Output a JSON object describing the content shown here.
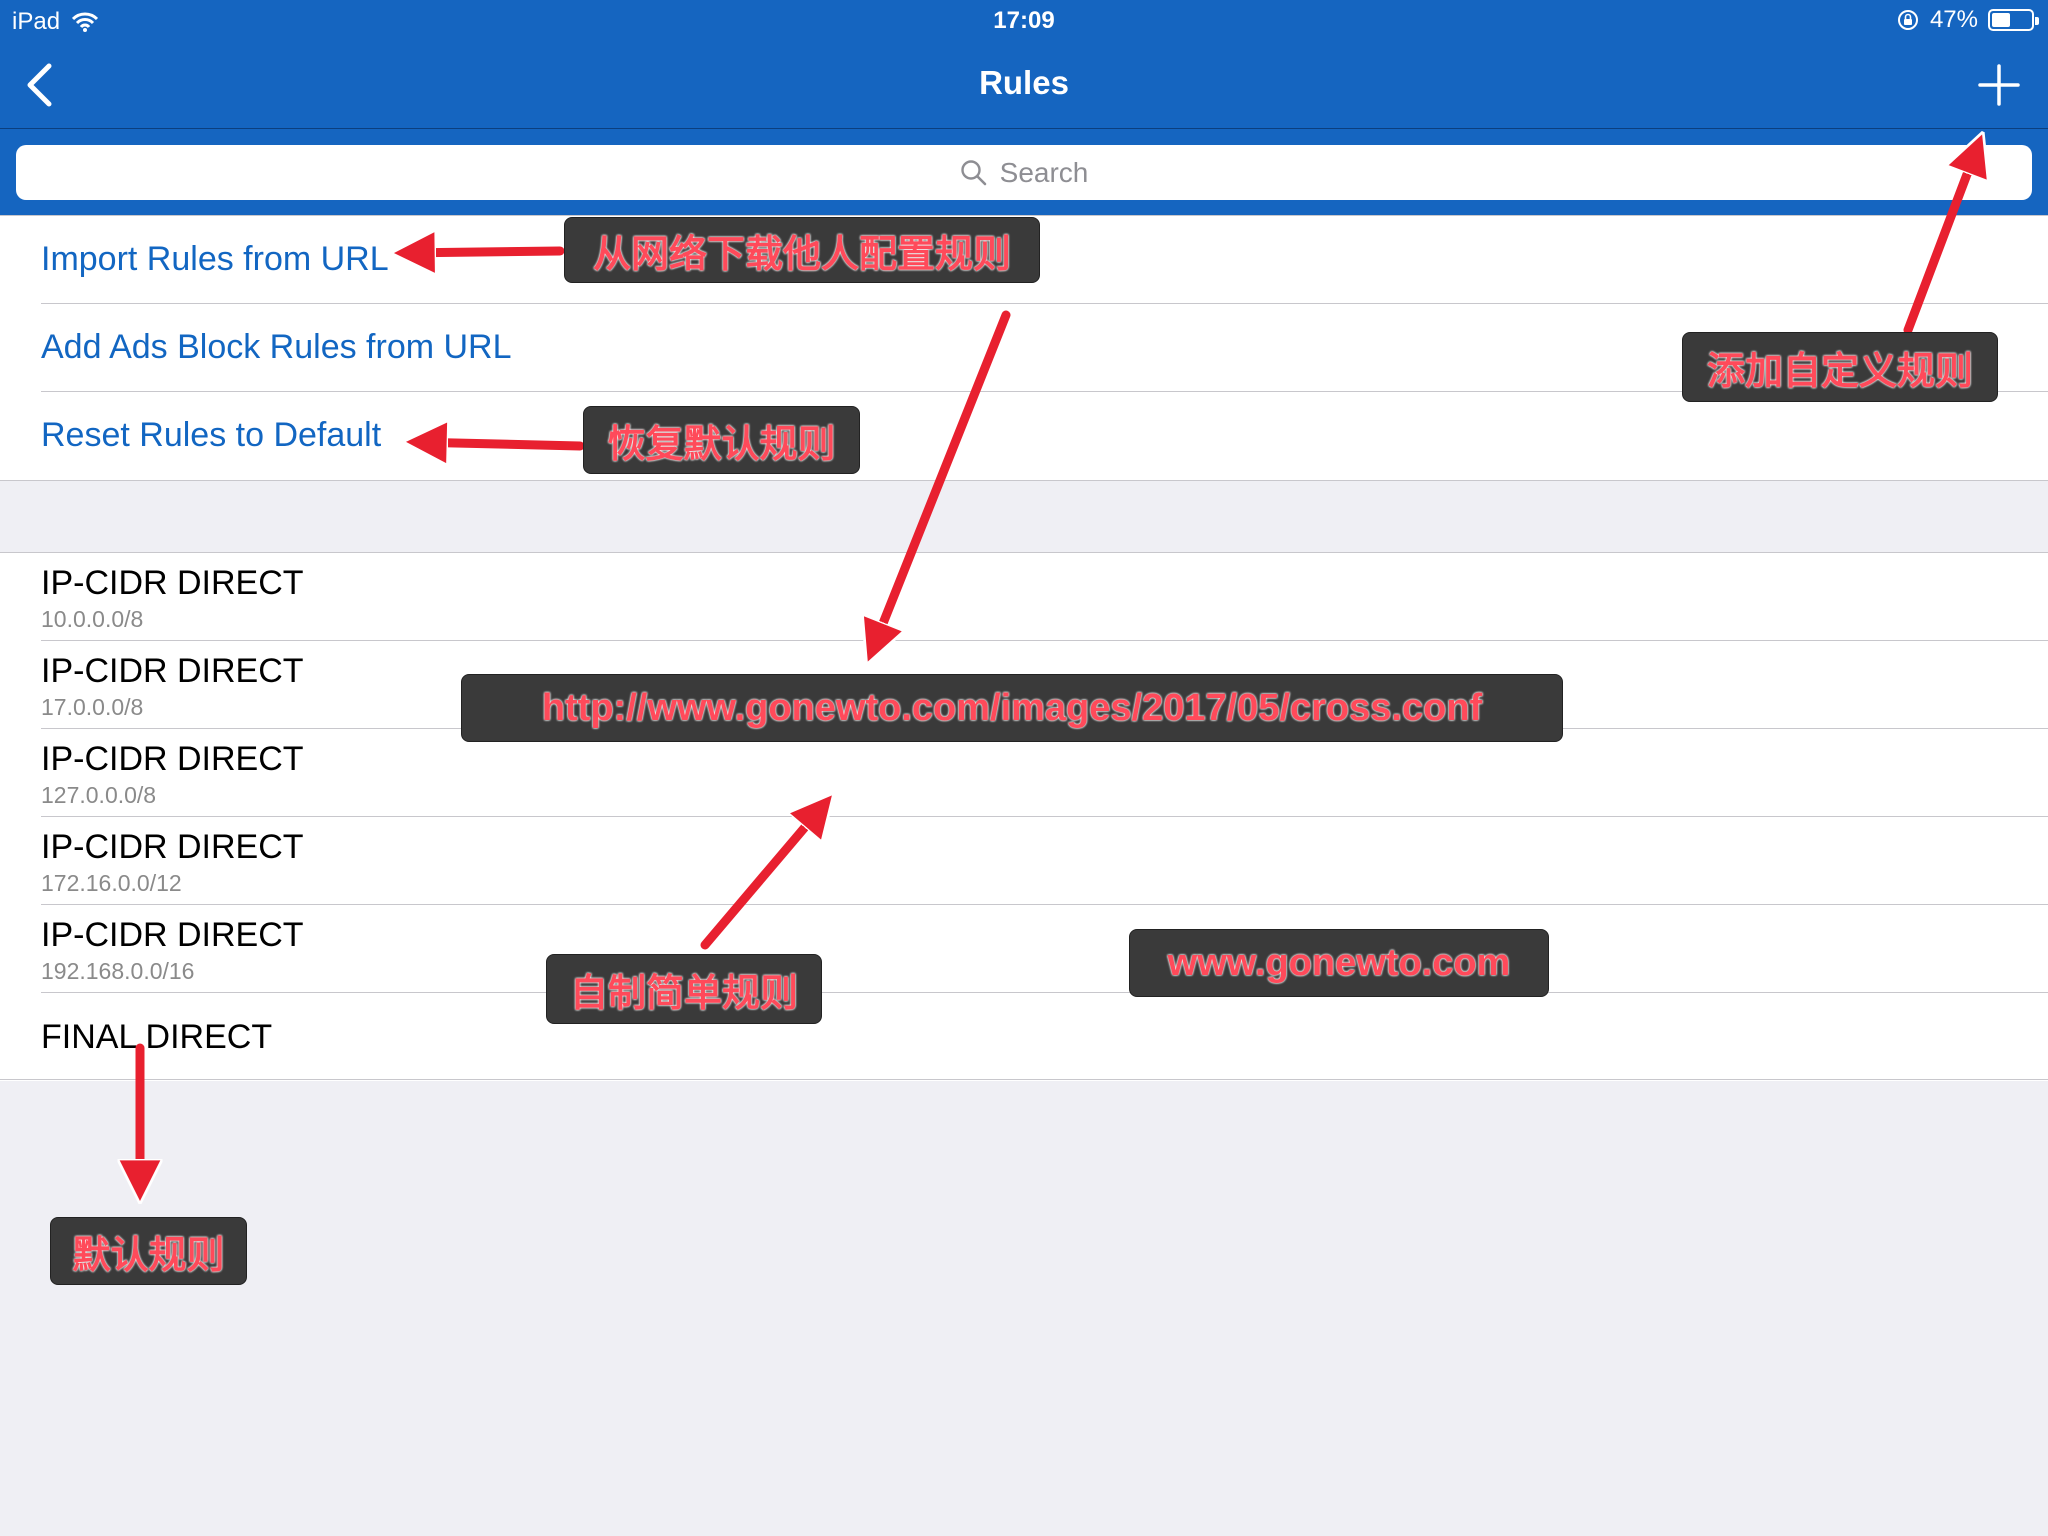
{
  "status_bar": {
    "device": "iPad",
    "time": "17:09",
    "battery_text": "47%",
    "battery_level": 0.47
  },
  "nav": {
    "title": "Rules",
    "back_icon": "chevron-left-icon",
    "add_icon": "plus-icon"
  },
  "search": {
    "placeholder": "Search"
  },
  "actions": [
    {
      "label": "Import Rules from URL"
    },
    {
      "label": "Add Ads Block Rules from URL"
    },
    {
      "label": "Reset Rules to Default"
    }
  ],
  "rules": [
    {
      "title": "IP-CIDR DIRECT",
      "value": "10.0.0.0/8"
    },
    {
      "title": "IP-CIDR DIRECT",
      "value": "17.0.0.0/8"
    },
    {
      "title": "IP-CIDR DIRECT",
      "value": "127.0.0.0/8"
    },
    {
      "title": "IP-CIDR DIRECT",
      "value": "172.16.0.0/12"
    },
    {
      "title": "IP-CIDR DIRECT",
      "value": "192.168.0.0/16"
    }
  ],
  "final_rule": {
    "title": "FINAL DIRECT"
  },
  "annotations": {
    "import": "从网络下载他人配置规则",
    "add_custom": "添加自定义规则",
    "reset": "恢复默认规则",
    "url": "http://www.gonewto.com/images/2017/05/cross.conf",
    "self_made": "自制简单规则",
    "watermark": "www.gonewto.com",
    "default": "默认规则"
  },
  "colors": {
    "nav_blue": "#1565c0",
    "link_blue": "#1266c2",
    "arrow_red": "#e8202f",
    "callout_bg": "#3a3a3a",
    "callout_text": "#ff4a5a"
  }
}
